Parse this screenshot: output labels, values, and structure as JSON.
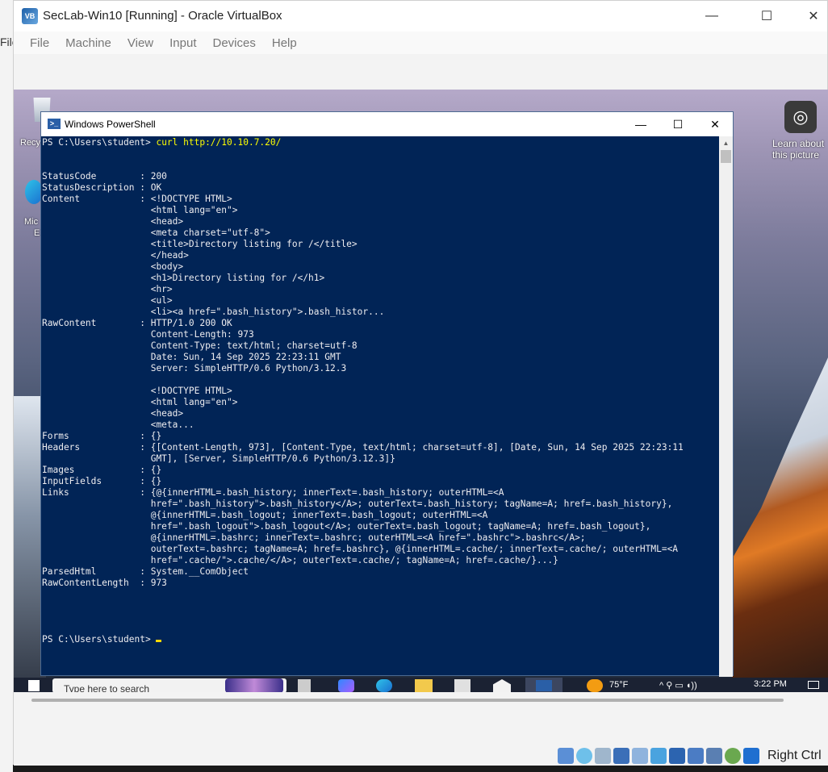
{
  "host": {
    "left_edge_text": "File"
  },
  "vbox": {
    "title": "SecLab-Win10 [Running] - Oracle VirtualBox",
    "menu": [
      "File",
      "Machine",
      "View",
      "Input",
      "Devices",
      "Help"
    ],
    "minimize_glyph": "—",
    "maximize_glyph": "☐",
    "close_glyph": "✕",
    "right_ctrl_label": "Right Ctrl"
  },
  "desktop": {
    "recycle_label": "Recy",
    "edge_label_1": "Mic",
    "edge_label_2": "E",
    "learn_label": "Learn about this picture"
  },
  "powershell": {
    "title": "Windows PowerShell",
    "prompt_prefix": "PS C:\\Users\\student> ",
    "command": "curl http://10.10.7.20/",
    "output_lines": [
      "",
      "",
      "StatusCode        : 200",
      "StatusDescription : OK",
      "Content           : <!DOCTYPE HTML>",
      "                    <html lang=\"en\">",
      "                    <head>",
      "                    <meta charset=\"utf-8\">",
      "                    <title>Directory listing for /</title>",
      "                    </head>",
      "                    <body>",
      "                    <h1>Directory listing for /</h1>",
      "                    <hr>",
      "                    <ul>",
      "                    <li><a href=\".bash_history\">.bash_histor...",
      "RawContent        : HTTP/1.0 200 OK",
      "                    Content-Length: 973",
      "                    Content-Type: text/html; charset=utf-8",
      "                    Date: Sun, 14 Sep 2025 22:23:11 GMT",
      "                    Server: SimpleHTTP/0.6 Python/3.12.3",
      "",
      "                    <!DOCTYPE HTML>",
      "                    <html lang=\"en\">",
      "                    <head>",
      "                    <meta...",
      "Forms             : {}",
      "Headers           : {[Content-Length, 973], [Content-Type, text/html; charset=utf-8], [Date, Sun, 14 Sep 2025 22:23:11",
      "                    GMT], [Server, SimpleHTTP/0.6 Python/3.12.3]}",
      "Images            : {}",
      "InputFields       : {}",
      "Links             : {@{innerHTML=.bash_history; innerText=.bash_history; outerHTML=<A",
      "                    href=\".bash_history\">.bash_history</A>; outerText=.bash_history; tagName=A; href=.bash_history},",
      "                    @{innerHTML=.bash_logout; innerText=.bash_logout; outerHTML=<A",
      "                    href=\".bash_logout\">.bash_logout</A>; outerText=.bash_logout; tagName=A; href=.bash_logout},",
      "                    @{innerHTML=.bashrc; innerText=.bashrc; outerHTML=<A href=\".bashrc\">.bashrc</A>;",
      "                    outerText=.bashrc; tagName=A; href=.bashrc}, @{innerHTML=.cache/; innerText=.cache/; outerHTML=<A",
      "                    href=\".cache/\">.cache/</A>; outerText=.cache/; tagName=A; href=.cache/}...}",
      "ParsedHtml        : System.__ComObject",
      "RawContentLength  : 973",
      "",
      "",
      "",
      ""
    ],
    "final_prompt": "PS C:\\Users\\student> "
  },
  "taskbar": {
    "search_placeholder": "Type here to search",
    "weather": "75°F",
    "clock": "3:22 PM"
  },
  "colors": {
    "ps_background": "#012456",
    "ps_text": "#eeedf0",
    "ps_command": "#ffff00"
  }
}
